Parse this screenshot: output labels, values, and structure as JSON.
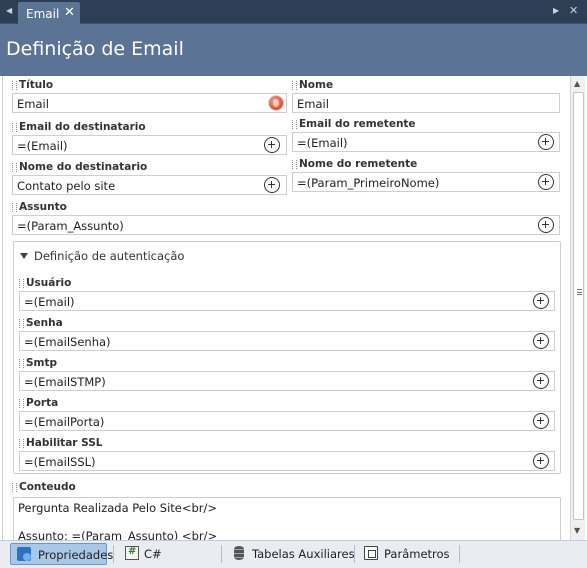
{
  "tab": {
    "label": "Email"
  },
  "header": {
    "title": "Definição de Email"
  },
  "fields": {
    "titulo": {
      "label": "Título",
      "value": "Email"
    },
    "nome": {
      "label": "Nome",
      "value": "Email"
    },
    "email_destinatario": {
      "label": "Email do destinatario",
      "value": "=(Email)"
    },
    "email_remetente": {
      "label": "Email do remetente",
      "value": "=(Email)"
    },
    "nome_destinatario": {
      "label": "Nome do destinatario",
      "value": "Contato pelo site"
    },
    "nome_remetente": {
      "label": "Nome do remetente",
      "value": "=(Param_PrimeiroNome)"
    },
    "assunto": {
      "label": "Assunto",
      "value": "=(Param_Assunto)"
    }
  },
  "auth": {
    "title": "Definição de autenticação",
    "usuario": {
      "label": "Usuário",
      "value": "=(Email)"
    },
    "senha": {
      "label": "Senha",
      "value": "=(EmailSenha)"
    },
    "smtp": {
      "label": "Smtp",
      "value": "=(EmailSTMP)"
    },
    "porta": {
      "label": "Porta",
      "value": "=(EmailPorta)"
    },
    "ssl": {
      "label": "Habilitar SSL",
      "value": "=(EmailSSL)"
    }
  },
  "conteudo": {
    "label": "Conteudo",
    "lines": [
      "Pergunta Realizada Pelo Site<br/>",
      "Assunto: =(Param_Assunto) <br/>"
    ]
  },
  "bottom_tabs": [
    {
      "label": "Propriedades",
      "icon": "properties-icon",
      "active": true
    },
    {
      "label": "C#",
      "icon": "csharp-file-icon",
      "active": false
    },
    {
      "label": "Tabelas Auxiliares",
      "icon": "database-icon",
      "active": false
    },
    {
      "label": "Parâmetros",
      "icon": "parameters-icon",
      "active": false
    }
  ],
  "colors": {
    "header_bg": "#5b7394",
    "tabstrip_bg": "#2e3f55",
    "active_tab_bg": "#a9c8e8"
  }
}
